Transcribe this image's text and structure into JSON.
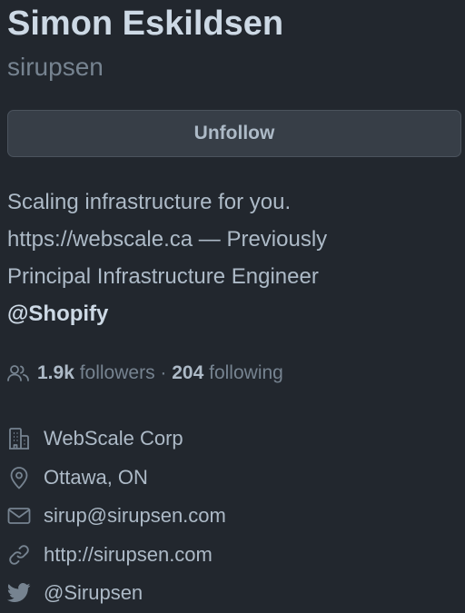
{
  "profile": {
    "full_name": "Simon Eskildsen",
    "username": "sirupsen",
    "follow_button_label": "Unfollow",
    "bio_lines": [
      "Scaling infrastructure for you.",
      "https://webscale.ca — Previously",
      "Principal Infrastructure Engineer"
    ],
    "bio_mention": "@Shopify",
    "followers_count": "1.9k",
    "followers_label": " followers",
    "separator": " · ",
    "following_count": "204",
    "following_label": " following",
    "details": {
      "organization": {
        "icon": "organization-icon",
        "text": "WebScale Corp"
      },
      "location": {
        "icon": "location-icon",
        "text": "Ottawa, ON"
      },
      "email": {
        "icon": "mail-icon",
        "text": "sirup@sirupsen.com"
      },
      "website": {
        "icon": "link-icon",
        "text": "http://sirupsen.com"
      },
      "twitter": {
        "icon": "twitter-icon",
        "text": "@Sirupsen"
      }
    }
  },
  "colors": {
    "background": "#22272e",
    "text_primary": "#cdd9e5",
    "text_default": "#adbac7",
    "text_muted": "#768390",
    "button_bg": "#373e47",
    "button_border": "#4b535d"
  }
}
